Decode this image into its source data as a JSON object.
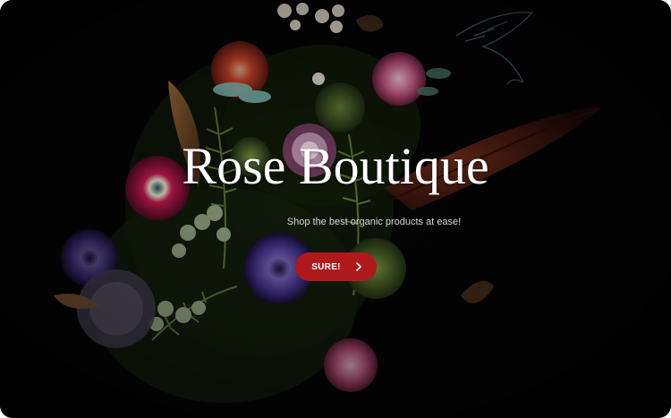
{
  "hero": {
    "title": "Rose Boutique",
    "subtitle": "Shop the best organic products at ease!",
    "cta_label": "SURE!",
    "cta_icon": "chevron-right-icon"
  },
  "colors": {
    "background": "#040404",
    "accent": "#b0191b",
    "title": "#ffffff",
    "subtitle": "#d9d9d9"
  }
}
